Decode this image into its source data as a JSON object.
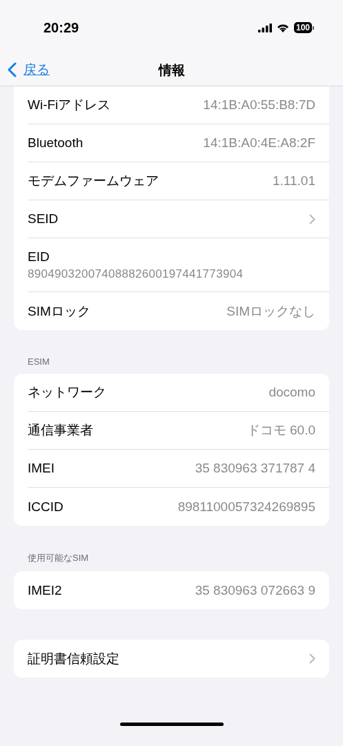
{
  "status_bar": {
    "time": "20:29",
    "battery": "100"
  },
  "nav": {
    "back": "戻る",
    "title": "情報"
  },
  "sections": [
    {
      "rows": [
        {
          "kind": "value",
          "label": "Wi-Fiアドレス",
          "value": "14:1B:A0:55:B8:7D"
        },
        {
          "kind": "value",
          "label": "Bluetooth",
          "value": "14:1B:A0:4E:A8:2F"
        },
        {
          "kind": "value",
          "label": "モデムファームウェア",
          "value": "1.11.01"
        },
        {
          "kind": "chevron",
          "label": "SEID"
        },
        {
          "kind": "stacked",
          "label": "EID",
          "value": "89049032007408882600197441773904"
        },
        {
          "kind": "value",
          "label": "SIMロック",
          "value": "SIMロックなし"
        }
      ]
    },
    {
      "header": "ESIM",
      "rows": [
        {
          "kind": "value",
          "label": "ネットワーク",
          "value": "docomo"
        },
        {
          "kind": "value",
          "label": "通信事業者",
          "value": "ドコモ 60.0"
        },
        {
          "kind": "value",
          "label": "IMEI",
          "value": "35 830963 371787 4"
        },
        {
          "kind": "value",
          "label": "ICCID",
          "value": "8981100057324269895"
        }
      ]
    },
    {
      "header": "使用可能なSIM",
      "rows": [
        {
          "kind": "value",
          "label": "IMEI2",
          "value": "35 830963 072663 9"
        }
      ]
    },
    {
      "rows": [
        {
          "kind": "chevron",
          "label": "証明書信頼設定"
        }
      ]
    }
  ]
}
